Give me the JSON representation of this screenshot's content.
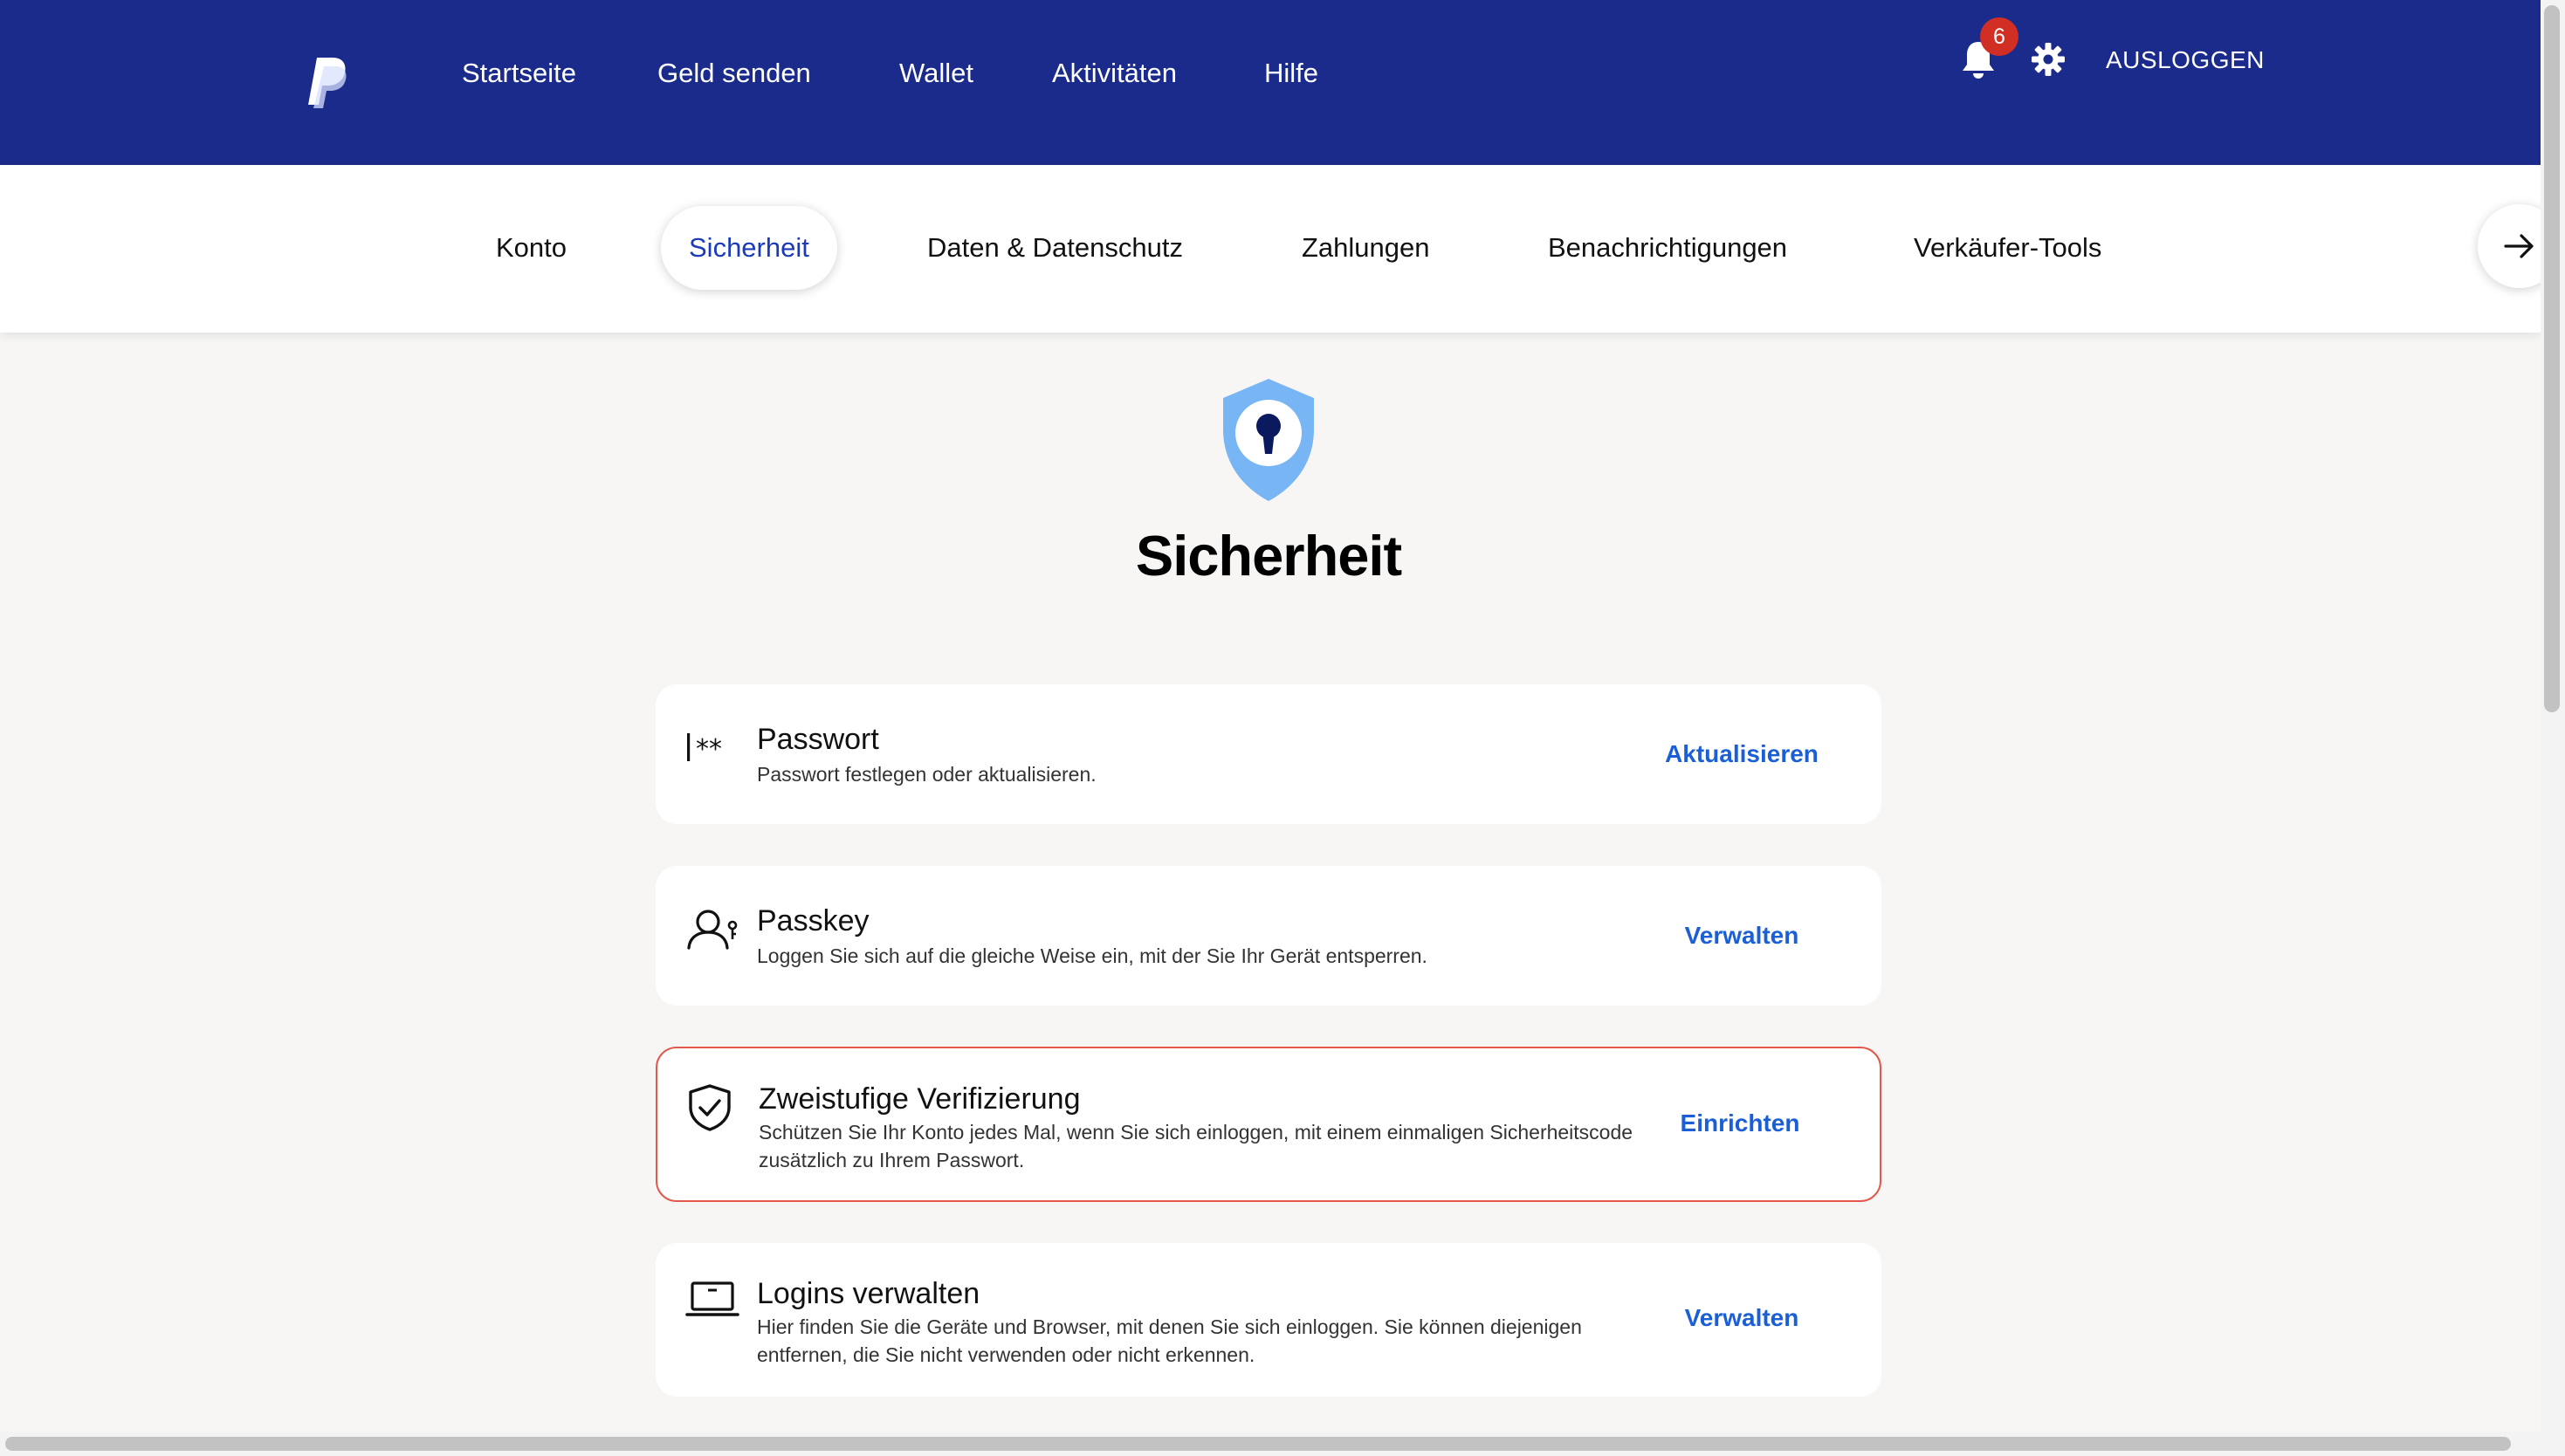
{
  "header": {
    "brand_icon": "paypal-logo",
    "nav": [
      "Startseite",
      "Geld senden",
      "Wallet",
      "Aktivitäten",
      "Hilfe"
    ],
    "notification_count": "6",
    "logout_label": "AUSLOGGEN",
    "colors": {
      "background": "#1a2b8b",
      "badge": "#d12f24"
    }
  },
  "subnav": {
    "tabs": [
      "Konto",
      "Sicherheit",
      "Daten & Datenschutz",
      "Zahlungen",
      "Benachrichtigungen",
      "Verkäufer-Tools"
    ],
    "active_tab": "Sicherheit",
    "next_icon": "arrow-right-icon"
  },
  "page": {
    "hero_icon": "shield-keyhole-icon",
    "title": "Sicherheit"
  },
  "cards": [
    {
      "icon": "password-icon",
      "title": "Passwort",
      "description": "Passwort festlegen oder aktualisieren.",
      "action": "Aktualisieren"
    },
    {
      "icon": "passkey-icon",
      "title": "Passkey",
      "description": "Loggen Sie sich auf die gleiche Weise ein, mit der Sie Ihr Gerät entsperren.",
      "action": "Verwalten"
    },
    {
      "icon": "shield-check-icon",
      "title": "Zweistufige Verifizierung",
      "description": "Schützen Sie Ihr Konto jedes Mal, wenn Sie sich einloggen, mit einem einmaligen Sicherheitscode zusätzlich zu Ihrem Passwort.",
      "action": "Einrichten",
      "highlighted": true
    },
    {
      "icon": "laptop-icon",
      "title": "Logins verwalten",
      "description": "Hier finden Sie die Geräte und Browser, mit denen Sie sich einloggen. Sie können diejenigen entfernen, die Sie nicht verwenden oder nicht erkennen.",
      "action": "Verwalten"
    }
  ],
  "colors": {
    "accent": "#1b5fd6",
    "highlight_border": "#e4574c",
    "page_background": "#f7f6f4"
  }
}
